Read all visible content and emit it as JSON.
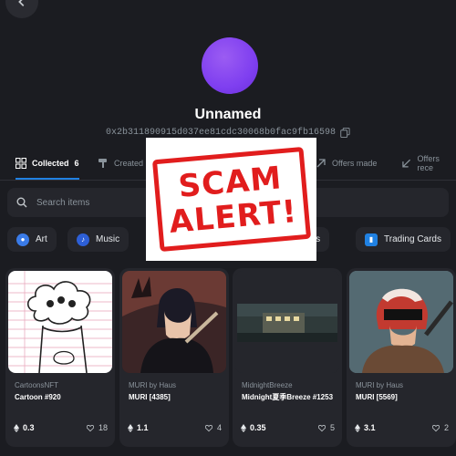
{
  "profile": {
    "name": "Unnamed",
    "address": "0x2b311890915d037ee81cdc30068b0fac9fb16598"
  },
  "tabs": [
    {
      "label": "Collected",
      "count": "6",
      "icon": "grid-icon",
      "active": true
    },
    {
      "label": "Created",
      "icon": "brush-icon"
    },
    {
      "label": "Offers made",
      "icon": "arrow-up-right-icon"
    },
    {
      "label": "Offers rece",
      "icon": "arrow-down-left-icon"
    }
  ],
  "search": {
    "placeholder": "Search items"
  },
  "categories": [
    {
      "label": "Art",
      "icon": "palette-icon",
      "color": "#3a7be8"
    },
    {
      "label": "Music",
      "icon": "music-icon",
      "color": "#2d5fd6"
    },
    {
      "label": "rlds",
      "icon": "globe-icon"
    },
    {
      "label": "Trading Cards",
      "icon": "card-icon",
      "color": "#2081e2"
    }
  ],
  "items": [
    {
      "collection": "CartoonsNFT",
      "name": "Cartoon #920",
      "price": "0.3",
      "likes": "18"
    },
    {
      "collection": "MURI by Haus",
      "name": "MURI [4385]",
      "price": "1.1",
      "likes": "4"
    },
    {
      "collection": "MidnightBreeze",
      "name": "Midnight夏季Breeze #1253",
      "price": "0.35",
      "likes": "5"
    },
    {
      "collection": "MURI by Haus",
      "name": "MURI [5569]",
      "price": "3.1",
      "likes": "2"
    }
  ],
  "overlay": {
    "line1": "SCAM",
    "line2": "ALERT!",
    "color": "#e11d1d"
  },
  "colors": {
    "background": "#1b1c21",
    "card": "#25262c",
    "accent": "#2081e2",
    "avatar": "#7f3ff0"
  }
}
